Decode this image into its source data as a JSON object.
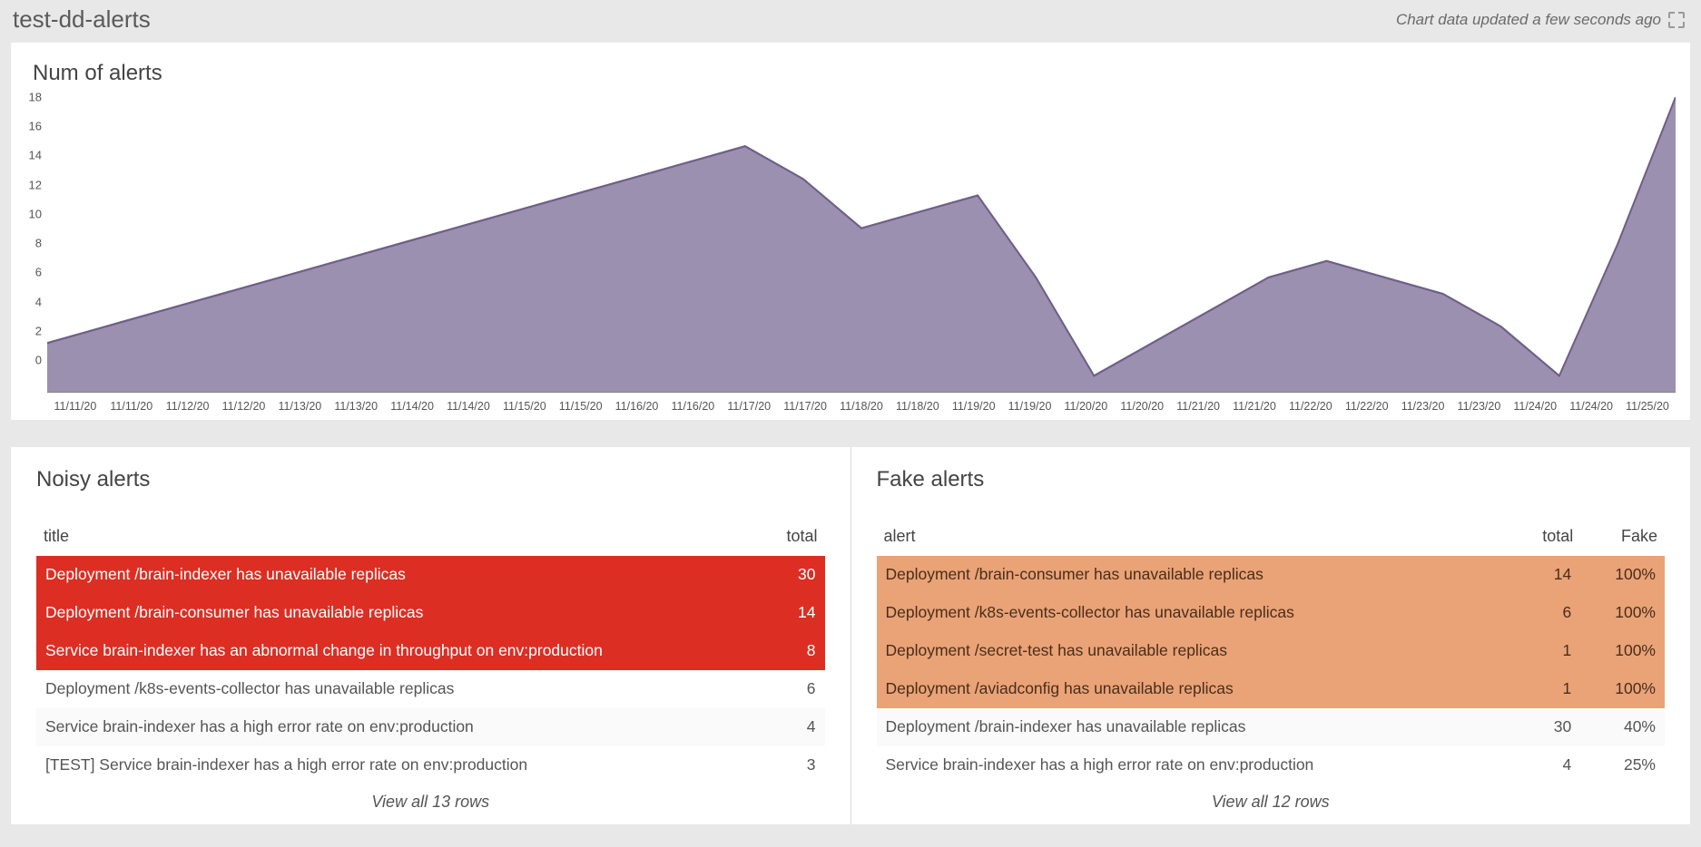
{
  "header": {
    "title": "test-dd-alerts",
    "updated": "Chart data updated a few seconds ago"
  },
  "chart_data": {
    "type": "area",
    "title": "Num of alerts",
    "ylim": [
      0,
      18
    ],
    "yticks": [
      0,
      2,
      4,
      6,
      8,
      10,
      12,
      14,
      16,
      18
    ],
    "categories": [
      "11/11/20",
      "11/11/20",
      "11/12/20",
      "11/12/20",
      "11/13/20",
      "11/13/20",
      "11/14/20",
      "11/14/20",
      "11/15/20",
      "11/15/20",
      "11/16/20",
      "11/16/20",
      "11/17/20",
      "11/17/20",
      "11/18/20",
      "11/18/20",
      "11/19/20",
      "11/19/20",
      "11/20/20",
      "11/20/20",
      "11/21/20",
      "11/21/20",
      "11/22/20",
      "11/22/20",
      "11/23/20",
      "11/23/20",
      "11/24/20",
      "11/24/20",
      "11/25/20"
    ],
    "values": [
      3,
      4,
      5,
      6,
      7,
      8,
      9,
      10,
      11,
      12,
      13,
      14,
      15,
      13,
      10,
      11,
      12,
      7,
      1,
      3,
      5,
      7,
      8,
      7,
      6,
      4,
      1,
      9,
      18
    ],
    "fill_color": "#8b7da3",
    "stroke_color": "#6e5f88"
  },
  "noisy": {
    "title": "Noisy alerts",
    "columns": [
      "title",
      "total"
    ],
    "rows": [
      {
        "title": "Deployment /brain-indexer has unavailable replicas",
        "total": 30,
        "severity": "red"
      },
      {
        "title": "Deployment /brain-consumer has unavailable replicas",
        "total": 14,
        "severity": "red"
      },
      {
        "title": "Service brain-indexer has an abnormal change in throughput on env:production",
        "total": 8,
        "severity": "red"
      },
      {
        "title": "Deployment /k8s-events-collector has unavailable replicas",
        "total": 6,
        "severity": "plain"
      },
      {
        "title": "Service brain-indexer has a high error rate on env:production",
        "total": 4,
        "severity": "plain"
      },
      {
        "title": "[TEST] Service brain-indexer has a high error rate on env:production",
        "total": 3,
        "severity": "plain"
      }
    ],
    "view_all": "View all 13 rows"
  },
  "fake": {
    "title": "Fake alerts",
    "columns": [
      "alert",
      "total",
      "Fake"
    ],
    "rows": [
      {
        "alert": "Deployment /brain-consumer has unavailable replicas",
        "total": 14,
        "fake": "100%",
        "severity": "orange"
      },
      {
        "alert": "Deployment /k8s-events-collector has unavailable replicas",
        "total": 6,
        "fake": "100%",
        "severity": "orange"
      },
      {
        "alert": "Deployment /secret-test has unavailable replicas",
        "total": 1,
        "fake": "100%",
        "severity": "orange"
      },
      {
        "alert": "Deployment /aviadconfig has unavailable replicas",
        "total": 1,
        "fake": "100%",
        "severity": "orange"
      },
      {
        "alert": "Deployment /brain-indexer has unavailable replicas",
        "total": 30,
        "fake": "40%",
        "severity": "plain"
      },
      {
        "alert": "Service brain-indexer has a high error rate on env:production",
        "total": 4,
        "fake": "25%",
        "severity": "plain"
      }
    ],
    "view_all": "View all 12 rows"
  }
}
